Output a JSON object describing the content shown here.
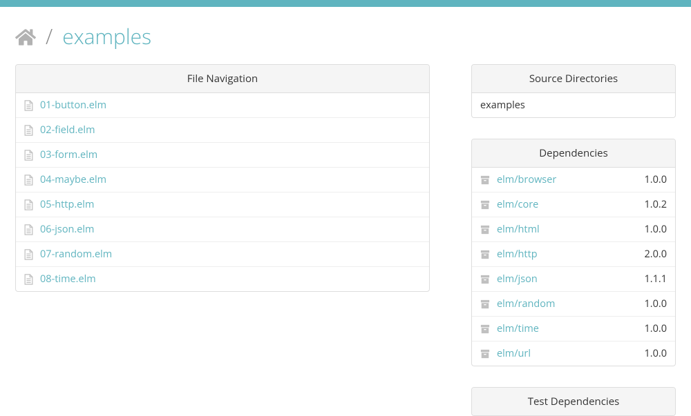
{
  "breadcrumb": {
    "separator": "/",
    "current": "examples"
  },
  "panels": {
    "file_nav_header": "File Navigation",
    "source_dirs_header": "Source Directories",
    "dependencies_header": "Dependencies",
    "test_deps_header": "Test Dependencies"
  },
  "files": [
    {
      "name": "01-button.elm"
    },
    {
      "name": "02-field.elm"
    },
    {
      "name": "03-form.elm"
    },
    {
      "name": "04-maybe.elm"
    },
    {
      "name": "05-http.elm"
    },
    {
      "name": "06-json.elm"
    },
    {
      "name": "07-random.elm"
    },
    {
      "name": "08-time.elm"
    }
  ],
  "source_dirs": [
    {
      "name": "examples"
    }
  ],
  "dependencies": [
    {
      "name": "elm/browser",
      "version": "1.0.0"
    },
    {
      "name": "elm/core",
      "version": "1.0.2"
    },
    {
      "name": "elm/html",
      "version": "1.0.0"
    },
    {
      "name": "elm/http",
      "version": "2.0.0"
    },
    {
      "name": "elm/json",
      "version": "1.1.1"
    },
    {
      "name": "elm/random",
      "version": "1.0.0"
    },
    {
      "name": "elm/time",
      "version": "1.0.0"
    },
    {
      "name": "elm/url",
      "version": "1.0.0"
    }
  ]
}
